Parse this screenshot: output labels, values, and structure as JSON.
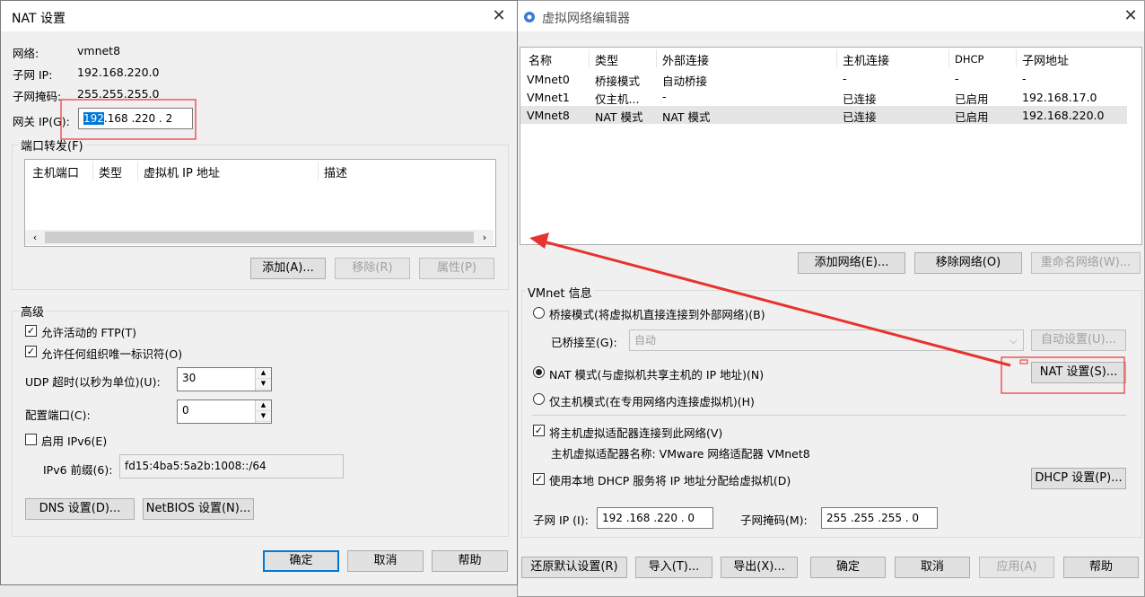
{
  "nat_dialog": {
    "title": "NAT 设置",
    "network_label": "网络:",
    "network_value": "vmnet8",
    "subnet_ip_label": "子网 IP:",
    "subnet_ip_value": "192.168.220.0",
    "subnet_mask_label": "子网掩码:",
    "subnet_mask_value": "255.255.255.0",
    "gateway_label": "网关 IP(G):",
    "gateway_sel": "192",
    "gateway_rest": ".168 .220 . 2",
    "port_forward_label": "端口转发(F)",
    "port_columns": [
      "主机端口",
      "类型",
      "虚拟机 IP 地址",
      "描述"
    ],
    "add_button": "添加(A)...",
    "remove_button": "移除(R)",
    "props_button": "属性(P)",
    "advanced_label": "高级",
    "allow_ftp": "允许活动的 FTP(T)",
    "allow_any_oui": "允许任何组织唯一标识符(O)",
    "udp_timeout_label": "UDP 超时(以秒为单位)(U):",
    "udp_timeout_value": "30",
    "config_port_label": "配置端口(C):",
    "config_port_value": "0",
    "enable_ipv6": "启用 IPv6(E)",
    "ipv6_prefix_label": "IPv6 前缀(6):",
    "ipv6_prefix_value": "fd15:4ba5:5a2b:1008::/64",
    "dns_button": "DNS 设置(D)...",
    "netbios_button": "NetBIOS 设置(N)...",
    "ok_button": "确定",
    "cancel_button": "取消",
    "help_button": "帮助"
  },
  "vne": {
    "title": "虚拟网络编辑器",
    "columns": [
      "名称",
      "类型",
      "外部连接",
      "主机连接",
      "DHCP",
      "子网地址"
    ],
    "rows": [
      [
        "VMnet0",
        "桥接模式",
        "自动桥接",
        "-",
        "-",
        "-"
      ],
      [
        "VMnet1",
        "仅主机...",
        "-",
        "已连接",
        "已启用",
        "192.168.17.0"
      ],
      [
        "VMnet8",
        "NAT 模式",
        "NAT 模式",
        "已连接",
        "已启用",
        "192.168.220.0"
      ]
    ],
    "add_network": "添加网络(E)...",
    "remove_network": "移除网络(O)",
    "rename_network": "重命名网络(W)...",
    "vmnet_info": "VMnet 信息",
    "bridged_mode": "桥接模式(将虚拟机直接连接到外部网络)(B)",
    "bridged_to_label": "已桥接至(G):",
    "bridged_to_value": "自动",
    "auto_settings": "自动设置(U)...",
    "nat_mode": "NAT 模式(与虚拟机共享主机的 IP 地址)(N)",
    "nat_settings": "NAT 设置(S)...",
    "host_only_mode": "仅主机模式(在专用网络内连接虚拟机)(H)",
    "connect_adapter": "将主机虚拟适配器连接到此网络(V)",
    "adapter_name": "主机虚拟适配器名称: VMware 网络适配器 VMnet8",
    "use_dhcp": "使用本地 DHCP 服务将 IP 地址分配给虚拟机(D)",
    "dhcp_settings": "DHCP 设置(P)...",
    "subnet_ip_label": "子网 IP (I):",
    "subnet_ip_value": "192 .168 .220 . 0",
    "subnet_mask_label": "子网掩码(M):",
    "subnet_mask_value": "255 .255 .255 . 0",
    "restore_defaults": "还原默认设置(R)",
    "import": "导入(T)...",
    "export": "导出(X)...",
    "ok": "确定",
    "cancel": "取消",
    "apply": "应用(A)",
    "help": "帮助"
  },
  "colors": {
    "annotation_red": "#e8322f",
    "selection_blue": "#0078d7"
  }
}
